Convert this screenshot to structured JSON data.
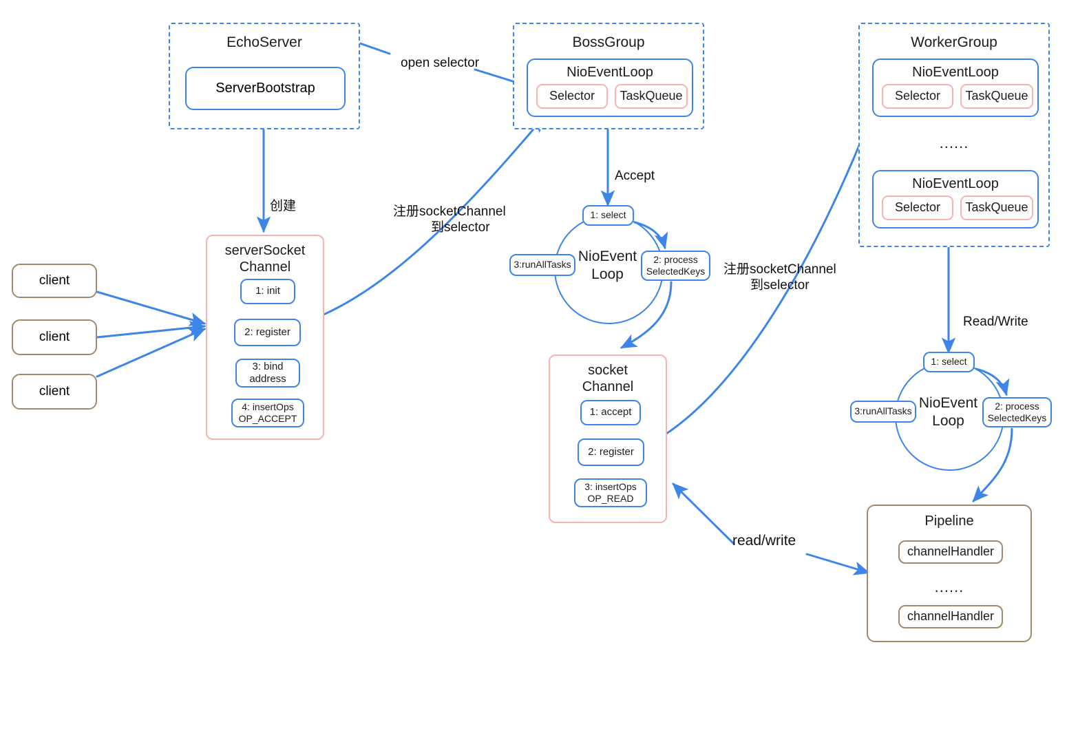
{
  "diagram": {
    "title": "Netty EchoServer Boss/Worker architecture",
    "colors": {
      "blue": "#3d85e8",
      "pink": "#f7b2b2",
      "brown": "#a08a6e",
      "text": "#101010",
      "background": "#ffffff"
    }
  },
  "echo_server": {
    "title": "EchoServer",
    "bootstrap": "ServerBootstrap"
  },
  "boss_group": {
    "title": "BossGroup",
    "event_loop": {
      "title": "NioEventLoop",
      "selector": "Selector",
      "task_queue": "TaskQueue"
    }
  },
  "worker_group": {
    "title": "WorkerGroup",
    "ellipsis": "......",
    "event_loops": [
      {
        "title": "NioEventLoop",
        "selector": "Selector",
        "task_queue": "TaskQueue"
      },
      {
        "title": "NioEventLoop",
        "selector": "Selector",
        "task_queue": "TaskQueue"
      }
    ]
  },
  "clients": [
    {
      "label": "client"
    },
    {
      "label": "client"
    },
    {
      "label": "client"
    }
  ],
  "server_socket_channel": {
    "title_line1": "serverSocket",
    "title_line2": "Channel",
    "steps": [
      {
        "line1": "1: init",
        "line2": ""
      },
      {
        "line1": "2: register",
        "line2": ""
      },
      {
        "line1": "3: bind",
        "line2": "address"
      },
      {
        "line1": "4: insertOps",
        "line2": "OP_ACCEPT"
      }
    ]
  },
  "socket_channel": {
    "title_line1": "socket",
    "title_line2": "Channel",
    "steps": [
      {
        "line1": "1: accept",
        "line2": ""
      },
      {
        "line1": "2: register",
        "line2": ""
      },
      {
        "line1": "3: insertOps",
        "line2": "OP_READ"
      }
    ]
  },
  "boss_event_loop_cycle": {
    "center_line1": "NioEvent",
    "center_line2": "Loop",
    "select": "1: select",
    "process_line1": "2: process",
    "process_line2": "SelectedKeys",
    "run_all_tasks": "3:runAllTasks"
  },
  "worker_event_loop_cycle": {
    "center_line1": "NioEvent",
    "center_line2": "Loop",
    "select": "1: select",
    "process_line1": "2: process",
    "process_line2": "SelectedKeys",
    "run_all_tasks": "3:runAllTasks"
  },
  "pipeline": {
    "title": "Pipeline",
    "ellipsis": "......",
    "handlers": [
      {
        "label": "channelHandler"
      },
      {
        "label": "channelHandler"
      }
    ]
  },
  "edge_labels": {
    "open_selector": "open selector",
    "create": "创建",
    "register_socket_channel_boss_line1": "注册socketChannel",
    "register_socket_channel_boss_line2": "到selector",
    "register_socket_channel_worker_line1": "注册socketChannel",
    "register_socket_channel_worker_line2": "到selector",
    "accept": "Accept",
    "read_write_upper": "Read/Write",
    "read_write_lower": "read/write"
  }
}
